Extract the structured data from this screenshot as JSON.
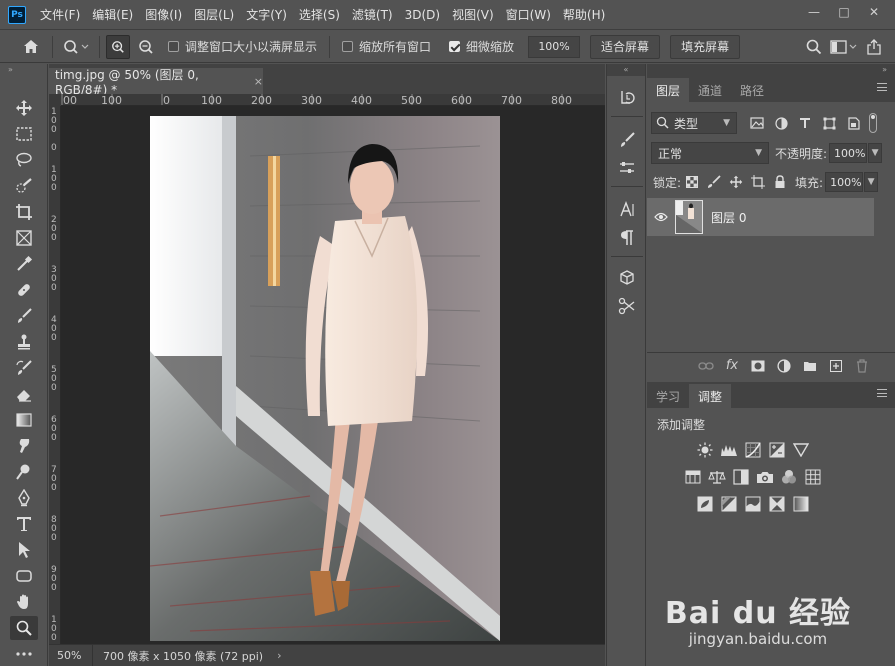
{
  "menubar": {
    "logo": "Ps",
    "items": [
      "文件(F)",
      "编辑(E)",
      "图像(I)",
      "图层(L)",
      "文字(Y)",
      "选择(S)",
      "滤镜(T)",
      "3D(D)",
      "视图(V)",
      "窗口(W)",
      "帮助(H)"
    ],
    "minimize": "—",
    "maximize": "□",
    "close": "✕"
  },
  "options": {
    "resize_windows": "调整窗口大小以满屏显示",
    "zoom_all": "缩放所有窗口",
    "scrubby_zoom": "细微缩放",
    "zoom_value": "100%",
    "fit_screen": "适合屏幕",
    "fill_screen": "填充屏幕",
    "resize_checked": false,
    "zoom_all_checked": false,
    "scrubby_checked": true
  },
  "document": {
    "tab_title": "timg.jpg @ 50% (图层 0, RGB/8#) *",
    "tab_close": "×",
    "ruler_h": [
      "00",
      "100",
      "0",
      "100",
      "200",
      "300",
      "400",
      "500",
      "600",
      "700",
      "800"
    ],
    "ruler_v": [
      "1\n0\n0",
      "0",
      "1\n0\n0",
      "2\n0\n0",
      "3\n0\n0",
      "4\n0\n0",
      "5\n0\n0",
      "6\n0\n0",
      "7\n0\n0",
      "8\n0\n0",
      "9\n0\n0",
      "1\n0\n0"
    ]
  },
  "status": {
    "zoom": "50%",
    "info": "700 像素 x 1050 像素 (72 ppi)",
    "arrow": "›"
  },
  "layers_panel": {
    "tabs": [
      "图层",
      "通道",
      "路径"
    ],
    "filter_kind": "类型",
    "blend_mode": "正常",
    "opacity_label": "不透明度:",
    "opacity_value": "100%",
    "lock_label": "锁定:",
    "fill_label": "填充:",
    "fill_value": "100%",
    "layer_name": "图层 0"
  },
  "adjust_panel": {
    "tabs": [
      "学习",
      "调整"
    ],
    "title": "添加调整"
  },
  "watermark": {
    "logo": "Bai du 经验",
    "url": "jingyan.baidu.com"
  },
  "panel_collapse": "»",
  "panel_expand": "«"
}
